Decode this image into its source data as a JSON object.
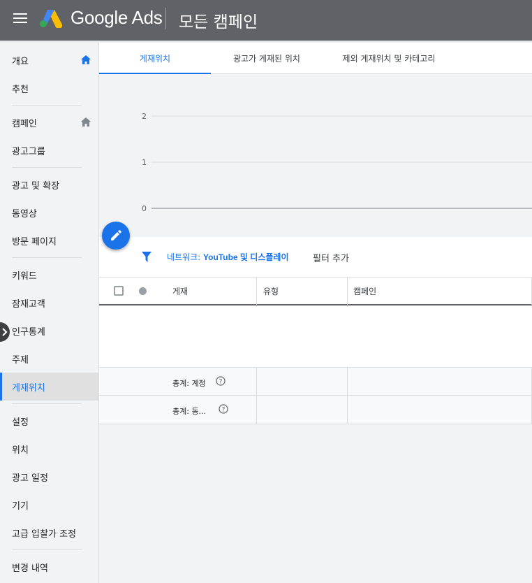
{
  "header": {
    "brand": "Google Ads",
    "page_title": "모든 캠페인"
  },
  "colors": {
    "header_bg": "#5f6368",
    "accent": "#1a73e8",
    "logo_yellow": "#fbbc04",
    "logo_blue": "#4285f4",
    "logo_green": "#34a853"
  },
  "sidebar": {
    "items": [
      {
        "label": "개요",
        "icon": "home-icon"
      },
      {
        "label": "추천"
      },
      {
        "label": "캠페인",
        "icon": "home-icon"
      },
      {
        "label": "광고그룹"
      },
      {
        "label": "광고 및 확장"
      },
      {
        "label": "동영상"
      },
      {
        "label": "방문 페이지"
      },
      {
        "label": "키워드"
      },
      {
        "label": "잠재고객"
      },
      {
        "label": "인구통계"
      },
      {
        "label": "주제"
      },
      {
        "label": "게재위치",
        "active": true
      },
      {
        "label": "설정"
      },
      {
        "label": "위치"
      },
      {
        "label": "광고 일정"
      },
      {
        "label": "기기"
      },
      {
        "label": "고급 입찰가 조정"
      },
      {
        "label": "변경 내역"
      }
    ]
  },
  "tabs": [
    {
      "label": "게재위치",
      "active": true
    },
    {
      "label": "광고가 게재된 위치"
    },
    {
      "label": "제외 게재위치 및 카테고리"
    }
  ],
  "chart_data": {
    "type": "line",
    "title": "",
    "xlabel": "",
    "ylabel": "",
    "ylim": [
      0,
      2
    ],
    "yticks": [
      "2",
      "1",
      "0"
    ],
    "series": [],
    "grid": true
  },
  "filter": {
    "chip_prefix": "네트워크: ",
    "chip_value": "YouTube 및 디스플레이",
    "add_label": "필터 추가"
  },
  "table": {
    "columns": [
      "게재",
      "유형",
      "캠페인"
    ],
    "totals": [
      "총계: 계정",
      "총계: 동..."
    ]
  }
}
